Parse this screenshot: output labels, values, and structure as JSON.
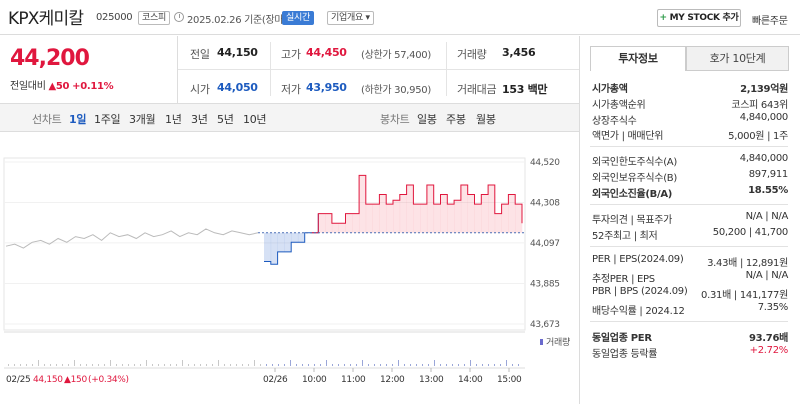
{
  "header": {
    "name": "KPX케미칼",
    "code": "025000",
    "market": "코스피",
    "date": "2025.02.26 기준(장마감)",
    "live_badge": "실시간",
    "info_badge": "기업개요",
    "mystock_label": "MY STOCK 추가",
    "quick_order": "빠른주문"
  },
  "quote": {
    "price": "44,200",
    "change_label": "전일대비",
    "change": "▲50",
    "change_pct": "+0.11%",
    "prev_label": "전일",
    "prev": "44,150",
    "high_label": "고가",
    "high": "44,450",
    "upper_limit": "(상한가 57,400)",
    "volume_label": "거래량",
    "volume": "3,456",
    "open_label": "시가",
    "open": "44,050",
    "low_label": "저가",
    "low": "43,950",
    "lower_limit": "(하한가 30,950)",
    "amount_label": "거래대금",
    "amount": "153 백만"
  },
  "controls": {
    "line_chart": "선차트",
    "periods": [
      "1일",
      "1주일",
      "3개월",
      "1년",
      "3년",
      "5년",
      "10년"
    ],
    "active_period": "1일",
    "candle_chart": "봉차트",
    "candle_periods": [
      "일봉",
      "주봉",
      "월봉"
    ]
  },
  "chart_data": {
    "type": "line",
    "y_ticks": [
      "44,520",
      "44,308",
      "44,097",
      "43,885",
      "43,673"
    ],
    "ylim": [
      43673,
      44520
    ],
    "reference": 44150,
    "x_ticks": [
      "02/26",
      "10:00",
      "11:00",
      "12:00",
      "13:00",
      "14:00",
      "15:00"
    ],
    "volume_label": "거래량",
    "footer": {
      "date": "02/25",
      "price": "44,150",
      "change": "▲150",
      "pct": "(+0.34%)"
    },
    "prev_day_series": [
      44080,
      44090,
      44070,
      44100,
      44110,
      44090,
      44120,
      44100,
      44130,
      44120,
      44140,
      44110,
      44150,
      44130,
      44140,
      44120,
      44150,
      44130,
      44140,
      44160,
      44130,
      44150,
      44140,
      44170,
      44150,
      44140,
      44160,
      44150,
      44140,
      44150
    ],
    "today_series": [
      44000,
      43985,
      44050,
      44050,
      44100,
      44100,
      44150,
      44150,
      44250,
      44250,
      44200,
      44200,
      44250,
      44250,
      44450,
      44300,
      44300,
      44350,
      44300,
      44320,
      44350,
      44400,
      44300,
      44300,
      44400,
      44300,
      44350,
      44300,
      44320,
      44400,
      44350,
      44300,
      44350,
      44400,
      44250,
      44300,
      44350,
      44300,
      44200
    ]
  },
  "sidebar": {
    "tab_info": "투자정보",
    "tab_quote": "호가 10단계",
    "rows": [
      {
        "k": "시가총액",
        "v": "2,139억원"
      },
      {
        "k": "시가총액순위",
        "v": "코스피 643위"
      },
      {
        "k": "상장주식수",
        "v": "4,840,000"
      },
      {
        "k": "액면가 | 매매단위",
        "v": "5,000원 | 1주"
      },
      {
        "k": "외국인한도주식수(A)",
        "v": "4,840,000"
      },
      {
        "k": "외국인보유주식수(B)",
        "v": "897,911"
      },
      {
        "k": "외국인소진율(B/A)",
        "v": "18.55%"
      },
      {
        "k": "투자의견 | 목표주가",
        "v": "N/A | N/A"
      },
      {
        "k": "52주최고 | 최저",
        "v": "50,200 | 41,700"
      },
      {
        "k": "PER | EPS(2024.09)",
        "v": "3.43배 | 12,891원"
      },
      {
        "k": "추정PER | EPS",
        "v": "N/A | N/A"
      },
      {
        "k": "PBR | BPS (2024.09)",
        "v": "0.31배 | 141,177원"
      },
      {
        "k": "배당수익률 | 2024.12",
        "v": "7.35%"
      },
      {
        "k": "동일업종 PER",
        "v": "93.76배"
      },
      {
        "k": "동일업종 등락률",
        "v": "+2.72%"
      }
    ],
    "colors": {
      "up": "#e0173e",
      "down": "#1d5bbf"
    }
  }
}
